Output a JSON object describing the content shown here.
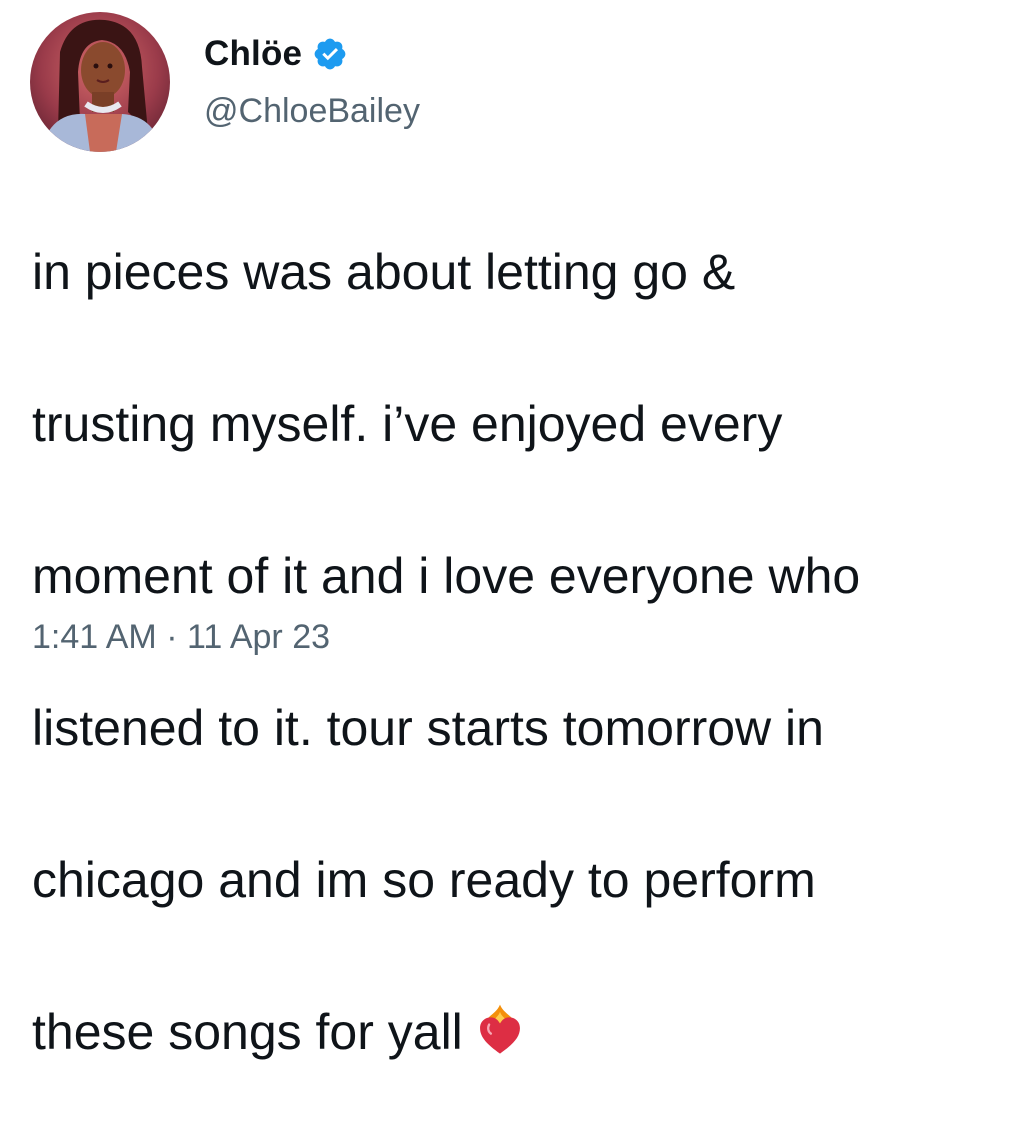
{
  "author": {
    "display_name": "Chlöe",
    "handle": "@ChloeBailey",
    "verified": true,
    "verified_color": "#1d9bf0"
  },
  "tweet": {
    "lines": [
      "in pieces was about letting go &",
      "trusting myself. i’ve enjoyed every",
      "moment of it and i love everyone who",
      "listened to it. tour starts tomorrow in",
      "chicago and im so ready to perform",
      "these songs for yall"
    ],
    "emoji": "heart-on-fire-icon"
  },
  "meta": {
    "time": "1:41 AM",
    "separator": "·",
    "date": "11 Apr 23"
  },
  "colors": {
    "text_primary": "#0f1419",
    "text_secondary": "#536471"
  }
}
